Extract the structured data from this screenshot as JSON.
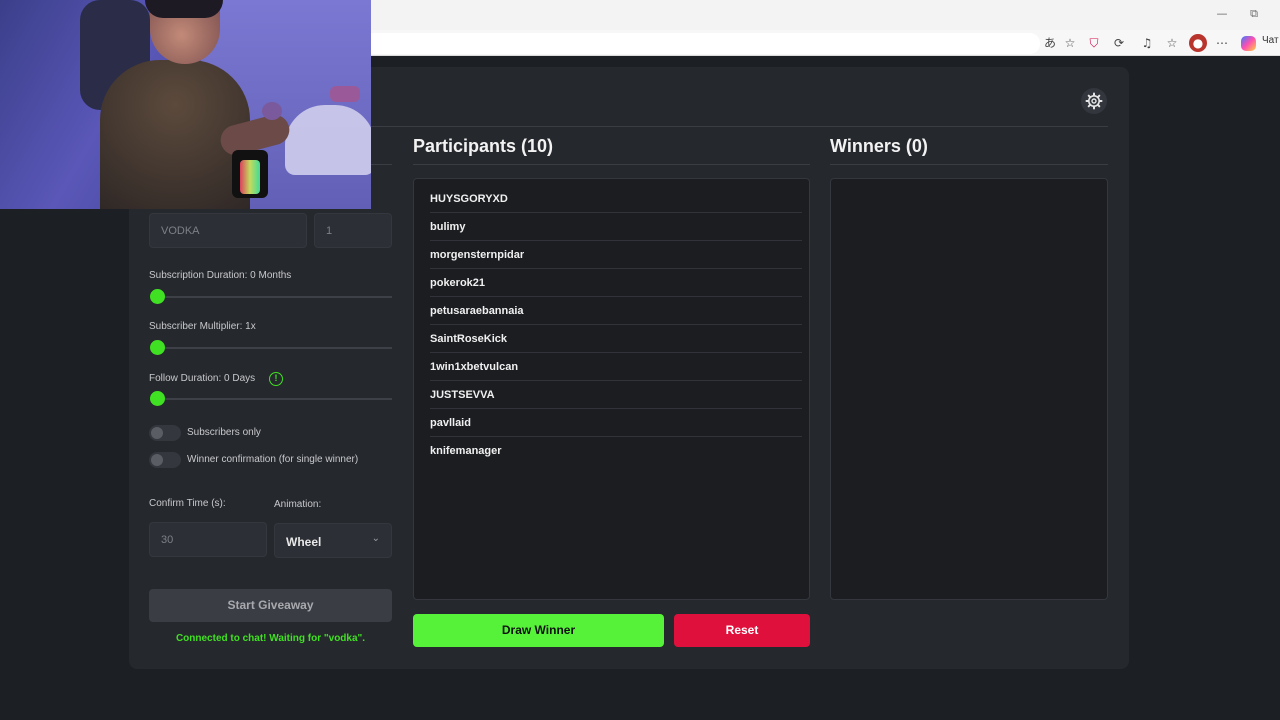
{
  "browser": {
    "minimize_glyph": "—",
    "restore_glyph": "⧉",
    "chat_label": "Чат"
  },
  "icons": {
    "gear": "⚙",
    "info": "!",
    "chevron": "⌄"
  },
  "participants": {
    "title": "Participants (10)",
    "names": [
      "HUYSGORYXD",
      "bulimy",
      "morgensternpidar",
      "pokerok21",
      "petusaraebannaia",
      "SaintRoseKick",
      "1win1xbetvulcan",
      "JUSTSEVVA",
      "pavllaid",
      "knifemanager"
    ]
  },
  "winners": {
    "title": "Winners (0)"
  },
  "actions": {
    "draw_label": "Draw Winner",
    "reset_label": "Reset"
  },
  "settings": {
    "keyword_value": "VODKA",
    "count_value": "1",
    "subscription_duration_label": "Subscription Duration: 0 Months",
    "subscription_duration_value": 0,
    "subscriber_multiplier_label": "Subscriber Multiplier: 1x",
    "subscriber_multiplier_value": 1,
    "follow_duration_label": "Follow Duration:  0  Days",
    "follow_duration_value": 0,
    "subscribers_only_label": "Subscribers only",
    "subscribers_only": false,
    "winner_confirmation_label": "Winner confirmation (for single winner)",
    "winner_confirmation": false,
    "confirm_time_label": "Confirm Time (s):",
    "confirm_time_value": "30",
    "animation_label": "Animation:",
    "animation_value": "Wheel",
    "start_label": "Start Giveaway",
    "status_text": "Connected to chat! Waiting for \"vodka\"."
  },
  "colors": {
    "accent_green": "#56f23a",
    "danger_red": "#e0103c",
    "panel_bg": "#25282d"
  }
}
